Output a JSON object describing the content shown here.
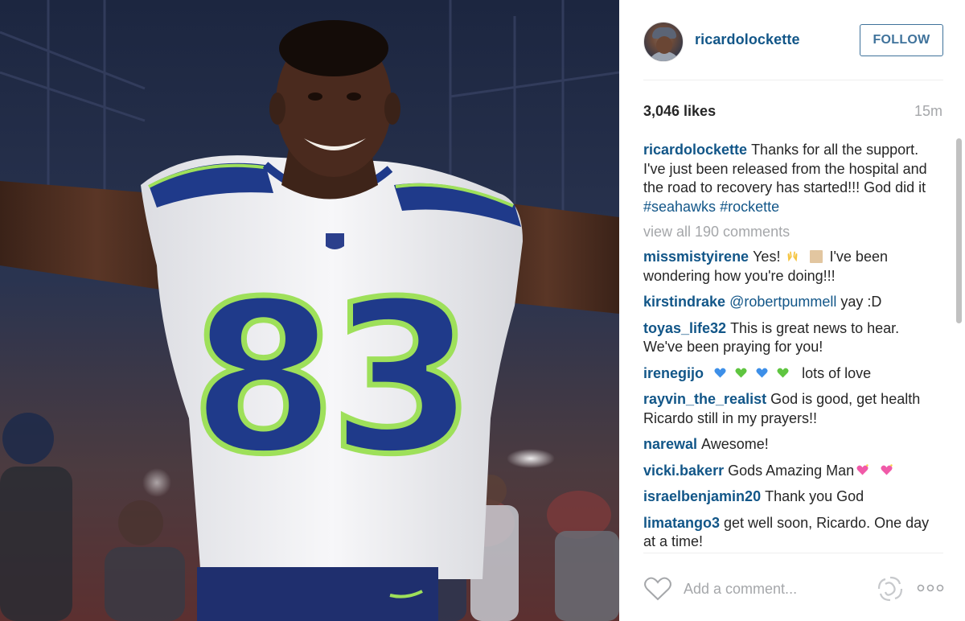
{
  "post": {
    "username": "ricardolockette",
    "follow_label": "FOLLOW",
    "likes": "3,046 likes",
    "time": "15m",
    "jersey_number": "83",
    "caption": {
      "user": "ricardolockette",
      "text": "Thanks for all the support. I've just been released from the hospital and the road to recovery has started!!! God did it",
      "tags": [
        "#seahawks",
        "#rockette"
      ]
    },
    "view_all": "view all 190 comments",
    "comments": [
      {
        "user": "missmistyirene",
        "text_before": "Yes!",
        "text_after": "I've been wondering how you're doing!!!"
      },
      {
        "user": "kirstindrake",
        "mention": "@robertpummell",
        "text": "yay :D"
      },
      {
        "user": "toyas_life32",
        "text": "This is great news to hear. We've been praying for you!"
      },
      {
        "user": "irenegijo",
        "text": "lots of love"
      },
      {
        "user": "rayvin_the_realist",
        "text": "God is good, get health Ricardo still in my prayers!!"
      },
      {
        "user": "narewal",
        "text": "Awesome!"
      },
      {
        "user": "vicki.bakerr",
        "text": "Gods Amazing Man"
      },
      {
        "user": "israelbenjamin20",
        "text": "Thank you God"
      },
      {
        "user": "limatango3",
        "text": "get well soon, Ricardo. One day at a time!"
      }
    ],
    "comment_placeholder": "Add a comment..."
  },
  "colors": {
    "link_blue": "#125688",
    "follow_blue": "#3f729b",
    "muted_gray": "#a5a7aa",
    "jersey_navy": "#1f3a8a",
    "jersey_green": "#9ee05a"
  },
  "icons": [
    "heart-icon",
    "loader-icon",
    "more-options-icon",
    "raised-hands-emoji",
    "blue-heart-emoji",
    "green-heart-emoji",
    "sparkling-heart-emoji"
  ]
}
